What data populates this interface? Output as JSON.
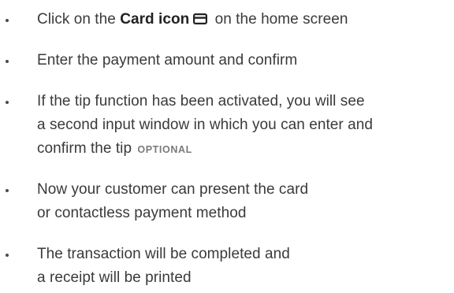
{
  "steps": [
    {
      "before": "Click on the ",
      "bold": "Card icon",
      "icon": "card-icon",
      "after": " on the home screen"
    },
    {
      "text": "Enter the payment amount and confirm"
    },
    {
      "lines": [
        "If the tip function has been activated, you will see",
        "a second input window in which you can enter and",
        "confirm the tip"
      ],
      "badge": "OPTIONAL"
    },
    {
      "lines": [
        "Now your customer can present the card",
        "or contactless payment method"
      ]
    },
    {
      "lines": [
        "The transaction will be completed and",
        "a receipt will be printed"
      ]
    }
  ]
}
